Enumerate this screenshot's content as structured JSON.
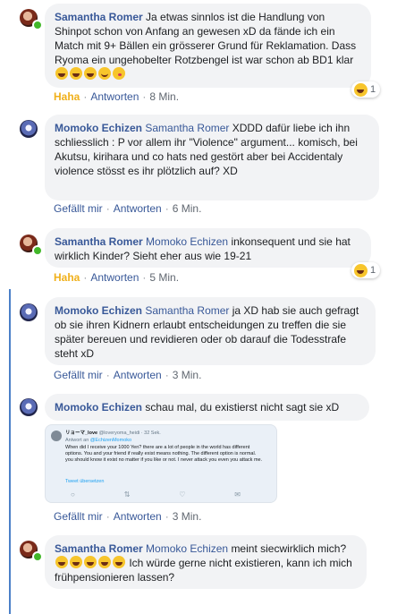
{
  "comments": [
    {
      "author": "Samantha Romer",
      "tag": "",
      "text": "Ja etwas sinnlos ist die Handlung von Shinpot schon von Anfang an gewesen xD da fände ich ein Match mit 9+ Bällen ein grösserer Grund für Reklamation. Dass Ryoma ein ungehobelter Rotzbengel ist war schon ab BD1 klar",
      "reaction_label": "Haha",
      "reply_label": "Antworten",
      "time": "8 Min.",
      "reaction_count": "1"
    },
    {
      "author": "Momoko Echizen",
      "tag": "Samantha Romer",
      "text": "XDDD dafür liebe ich ihn schliesslich : P vor allem ihr \"Violence\" argument... komisch, bei Akutsu, kirihara und co hats ned gestört aber bei Accidentaly violence stösst es ihr plötzlich auf? XD",
      "like_label": "Gefällt mir",
      "reply_label": "Antworten",
      "time": "6 Min."
    },
    {
      "author": "Samantha Romer",
      "tag": "Momoko Echizen",
      "text": "inkonsequent und sie hat wirklich Kinder? Sieht eher aus wie 19-21",
      "reaction_label": "Haha",
      "reply_label": "Antworten",
      "time": "5 Min.",
      "reaction_count": "1"
    },
    {
      "author": "Momoko Echizen",
      "tag": "Samantha Romer",
      "text": "ja XD hab sie auch gefragt ob sie ihren Kidnern erlaubt entscheidungen zu treffen die sie später bereuen und revidieren oder ob darauf die Todesstrafe steht xD",
      "like_label": "Gefällt mir",
      "reply_label": "Antworten",
      "time": "3 Min."
    },
    {
      "author": "Momoko Echizen",
      "tag": "",
      "text": "schau mal, du existierst nicht sagt sie xD",
      "like_label": "Gefällt mir",
      "reply_label": "Antworten",
      "time": "3 Min."
    },
    {
      "author": "Samantha Romer",
      "tag": "Momoko Echizen",
      "text_a": "meint siecwirklich mich?",
      "text_b": "Ich würde gerne nicht existieren, kann ich mich frühpensionieren lassen?"
    }
  ],
  "tweet": {
    "user": "リョーマ_love",
    "handle": "@loveryoma_heidi · 32 Sek.",
    "reply_prefix": "Antwort an",
    "reply_to": "@EchizenMomoko",
    "text": "When did I receive your 1000 Yen? there are a lot of people in the world has different options. You and your friend if really exist means nothing. The different option is normal. you should know it exist no matter if you like or not. I never attack you even you attack me.",
    "translate": "Tweet übersetzen"
  },
  "icons": [
    "haha-emoji-icon",
    "blush-emoji-icon",
    "kiss-emoji-icon",
    "reply-icon",
    "retweet-icon",
    "like-heart-icon",
    "mail-icon"
  ]
}
